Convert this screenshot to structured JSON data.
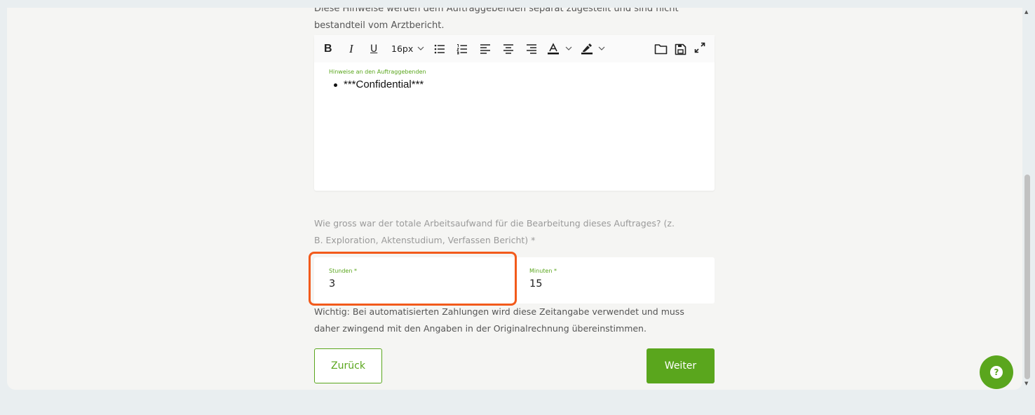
{
  "hint_text": "Diese Hinweise werden dem Auftraggebenden separat zugestellt und sind nicht bestandteil vom Arztbericht.",
  "editor": {
    "toolbar": {
      "bold": "B",
      "italic": "I",
      "underline": "U",
      "font_size": "16px",
      "icons": [
        "bold-icon",
        "italic-icon",
        "underline-icon",
        "chevron-down-icon",
        "bullet-list-icon",
        "numbered-list-icon",
        "align-left-icon",
        "align-center-icon",
        "align-right-icon",
        "text-color-icon",
        "highlight-icon",
        "folder-icon",
        "save-icon",
        "expand-icon"
      ]
    },
    "label": "Hinweise an den Auftraggebenden",
    "content": "***Confidential***"
  },
  "question": "Wie gross war der totale Arbeitsaufwand für die Bearbeitung dieses Auftrages? (z. B. Exploration, Aktenstudium, Verfassen Bericht) *",
  "fields": {
    "hours_label": "Stunden *",
    "hours_value": "3",
    "minutes_label": "Minuten *",
    "minutes_value": "15"
  },
  "note": "Wichtig: Bei automatisierten Zahlungen wird diese Zeitangabe verwendet und muss daher zwingend mit den Angaben in der Originalrechnung übereinstimmen.",
  "buttons": {
    "back": "Zurück",
    "next": "Weiter"
  },
  "help_glyph": "?",
  "colors": {
    "accent": "#5aa61d",
    "highlight": "#f25a1b",
    "background": "#e9eef0",
    "card": "#f5f5f3"
  }
}
